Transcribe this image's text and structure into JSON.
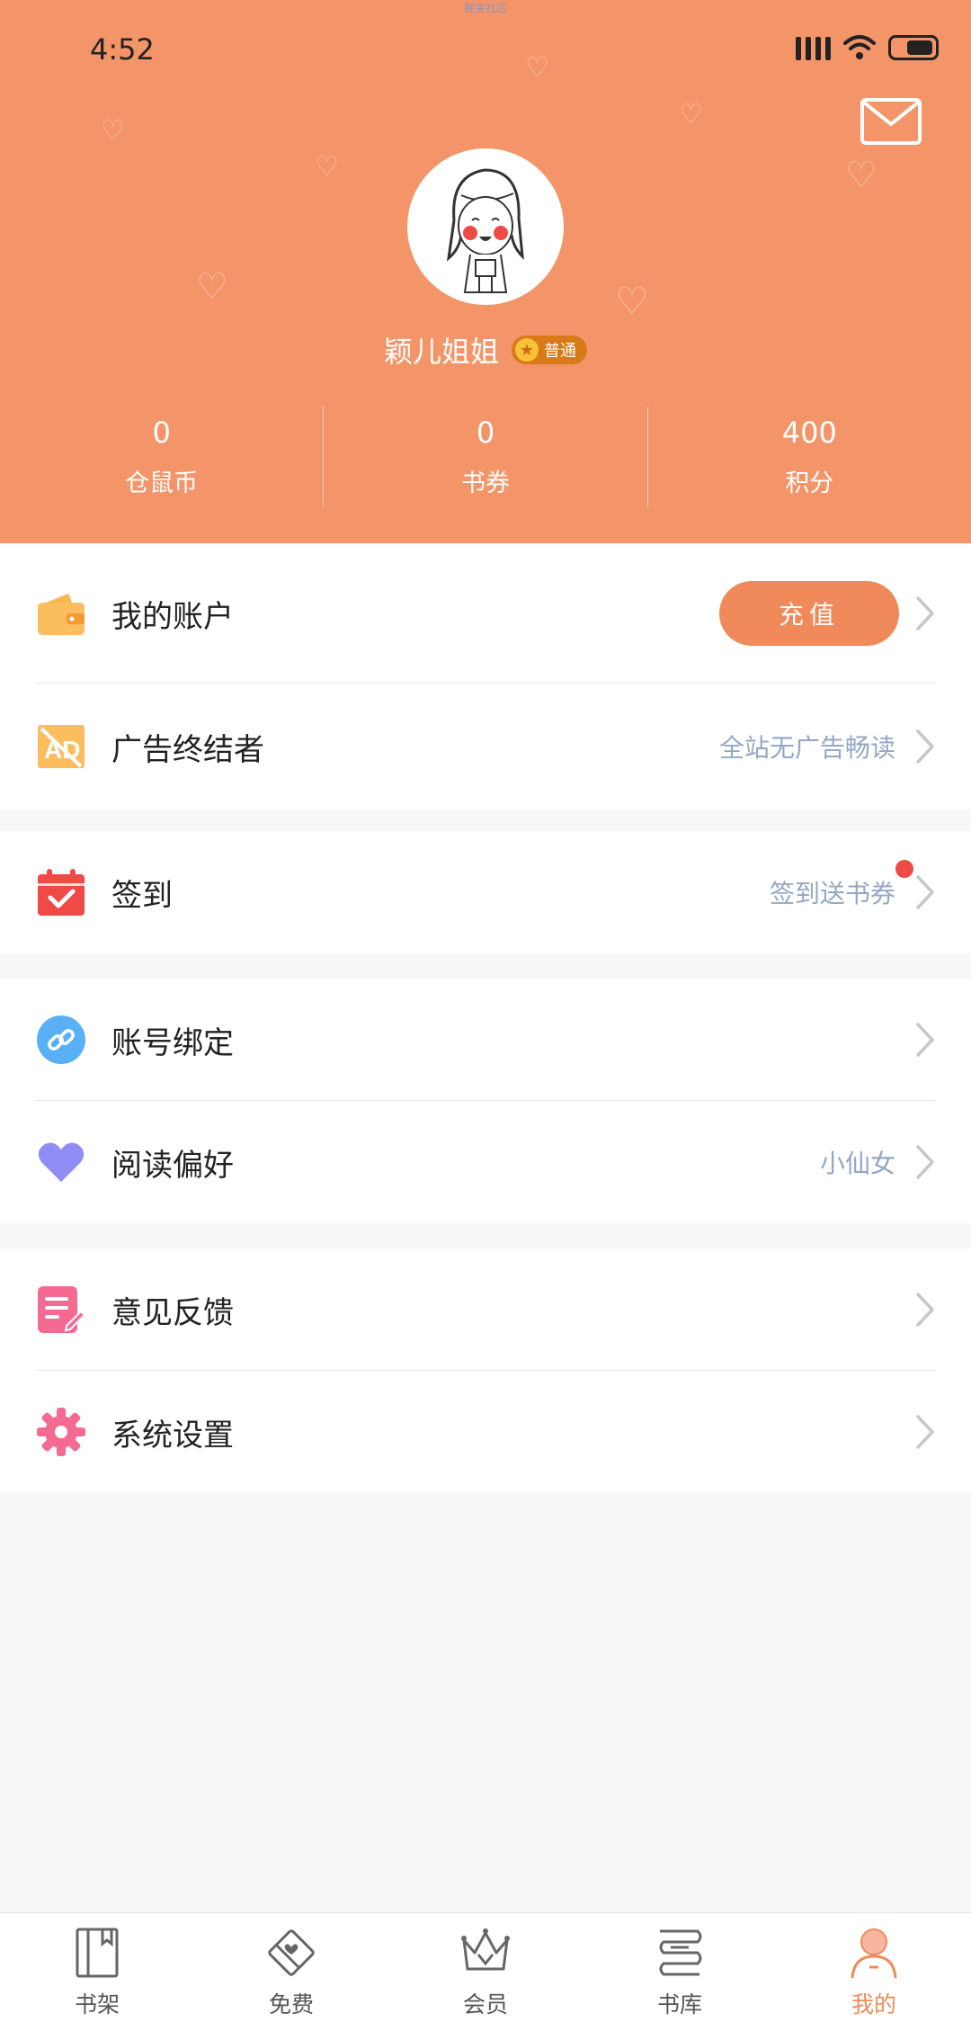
{
  "status_bar": {
    "time": "4:52",
    "watermark": "掘金社区"
  },
  "profile": {
    "username": "颖儿姐姐",
    "level_badge": "普通",
    "stats": [
      {
        "value": "0",
        "label": "仓鼠币"
      },
      {
        "value": "0",
        "label": "书券"
      },
      {
        "value": "400",
        "label": "积分"
      }
    ]
  },
  "menu": {
    "account": {
      "label": "我的账户",
      "button": "充值"
    },
    "ad_terminator": {
      "label": "广告终结者",
      "hint": "全站无广告畅读"
    },
    "checkin": {
      "label": "签到",
      "hint": "签到送书券"
    },
    "account_binding": {
      "label": "账号绑定"
    },
    "reading_pref": {
      "label": "阅读偏好",
      "hint": "小仙女"
    },
    "feedback": {
      "label": "意见反馈"
    },
    "settings": {
      "label": "系统设置"
    }
  },
  "bottom_nav": [
    {
      "label": "书架",
      "icon": "bookshelf-icon"
    },
    {
      "label": "免费",
      "icon": "free-ticket-icon"
    },
    {
      "label": "会员",
      "icon": "crown-icon"
    },
    {
      "label": "书库",
      "icon": "library-icon"
    },
    {
      "label": "我的",
      "icon": "profile-icon",
      "active": true
    }
  ],
  "colors": {
    "header_bg": "#f39569",
    "accent": "#f08a5a",
    "hint_text": "#93a7c4",
    "red_dot": "#ef4a45"
  }
}
